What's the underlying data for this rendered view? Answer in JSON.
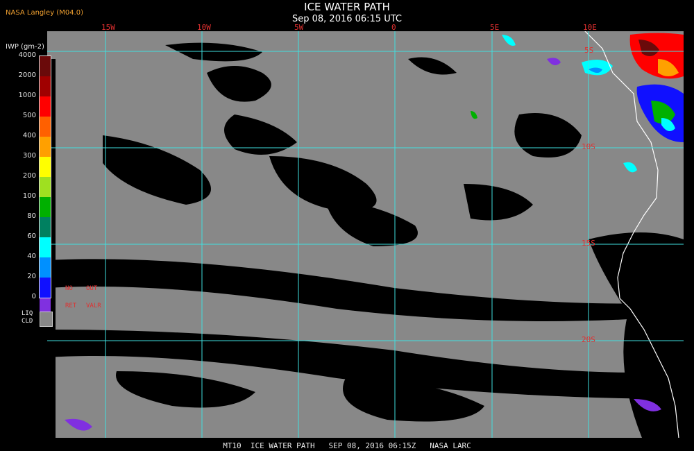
{
  "header": {
    "credit": "NASA Langley (M04.0)",
    "title": "ICE WATER PATH",
    "subtitle": "Sep 08, 2016 06:15 UTC"
  },
  "grid": {
    "longitudes": [
      "15W",
      "10W",
      "5W",
      "0",
      "5E",
      "10E"
    ],
    "latitudes": [
      "5S",
      "10S",
      "15S",
      "20S"
    ],
    "line_color": "#40e0e0",
    "label_color": "#e03030"
  },
  "colorbar": {
    "title": "IWP (gm-2)",
    "levels": [
      {
        "label": "4000",
        "color": "#6a0a0a"
      },
      {
        "label": "2000",
        "color": "#a00000"
      },
      {
        "label": "1000",
        "color": "#ff0000"
      },
      {
        "label": "500",
        "color": "#ff6000"
      },
      {
        "label": "400",
        "color": "#ffa000"
      },
      {
        "label": "300",
        "color": "#ffff00"
      },
      {
        "label": "200",
        "color": "#9fe020"
      },
      {
        "label": "100",
        "color": "#00b000"
      },
      {
        "label": "80",
        "color": "#008060"
      },
      {
        "label": "60",
        "color": "#00ffff"
      },
      {
        "label": "40",
        "color": "#0090ff"
      },
      {
        "label": "20",
        "color": "#1010ff"
      },
      {
        "label": "0",
        "color": "#8030e0"
      }
    ],
    "no_ret": "NO\nRET",
    "out_valr": "OUT\nVALR",
    "liq_cld": "LIQ\nCLD",
    "liq_color": "#888888"
  },
  "map_colors": {
    "clear": "#000000",
    "liquid_cloud": "#888888",
    "coastline": "#ffffff"
  },
  "footer": "MT10  ICE WATER PATH   SEP 08, 2016 06:15Z   NASA LARC"
}
